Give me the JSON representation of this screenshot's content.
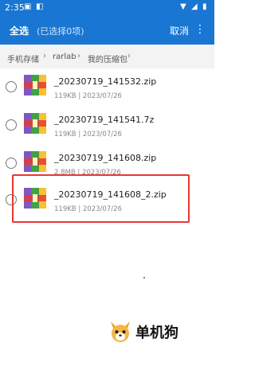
{
  "status_bar": {
    "time": "2:35"
  },
  "header": {
    "select_all": "全选",
    "selected_count": "(已选择0项)",
    "cancel": "取消"
  },
  "breadcrumb": [
    "手机存储",
    "rarlab",
    "我的压缩包"
  ],
  "files": [
    {
      "name": "_20230719_141532.zip",
      "size": "119KB",
      "date": "2023/07/26"
    },
    {
      "name": "_20230719_141541.7z",
      "size": "119KB",
      "date": "2023/07/26"
    },
    {
      "name": "_20230719_141608.zip",
      "size": "2.8MB",
      "date": "2023/07/26"
    },
    {
      "name": "_20230719_141608_2.zip",
      "size": "119KB",
      "date": "2023/07/26"
    }
  ],
  "meta_separator": "|",
  "watermark": "单机狗",
  "colors": {
    "accent": "#1976d2",
    "highlight": "#e53935"
  }
}
